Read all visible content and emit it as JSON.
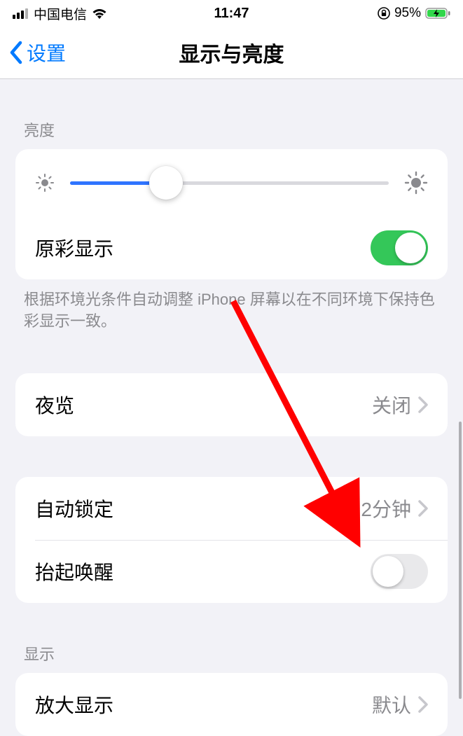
{
  "status_bar": {
    "carrier": "中国电信",
    "time": "11:47",
    "battery_percent": "95%"
  },
  "nav": {
    "back_label": "设置",
    "title": "显示与亮度"
  },
  "brightness_section": {
    "header": "亮度",
    "slider_percent": 30,
    "true_tone_label": "原彩显示",
    "true_tone_on": true,
    "footer": "根据环境光条件自动调整 iPhone 屏幕以在不同环境下保持色彩显示一致。"
  },
  "night_shift": {
    "label": "夜览",
    "value": "关闭"
  },
  "auto_lock": {
    "label": "自动锁定",
    "value": "2分钟"
  },
  "raise_to_wake": {
    "label": "抬起唤醒",
    "on": false
  },
  "display_section": {
    "header": "显示",
    "zoom_label": "放大显示",
    "zoom_value": "默认"
  },
  "colors": {
    "accent": "#007aff",
    "toggle_on": "#34c759",
    "arrow": "#ff0000"
  }
}
